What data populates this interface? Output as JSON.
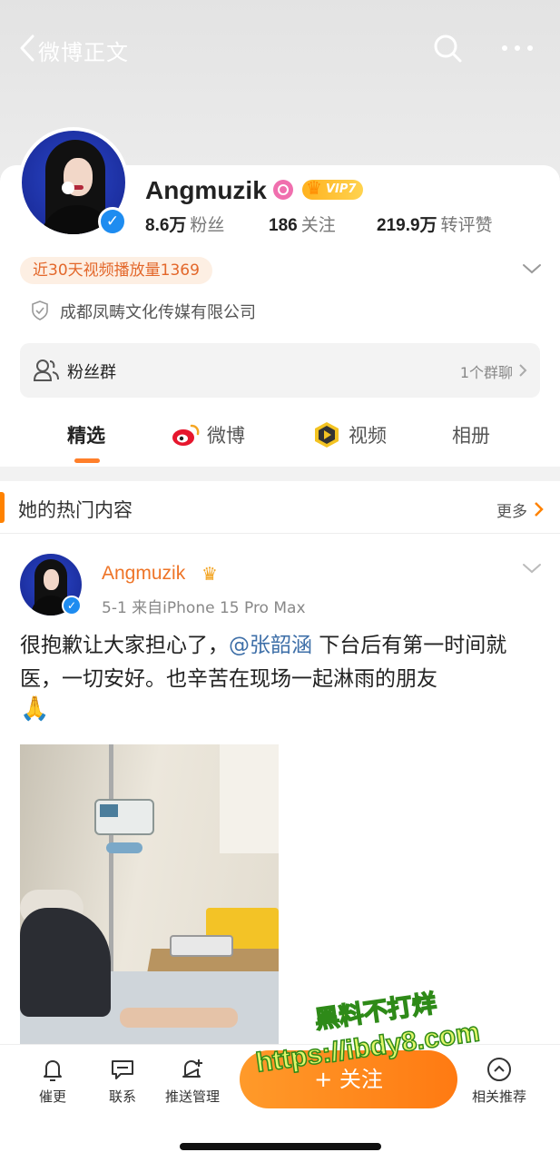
{
  "nav": {
    "title": "微博正文"
  },
  "profile": {
    "name": "Angmuzik",
    "vip_label": "VIP7",
    "stats": [
      {
        "num": "8.6万",
        "label": "粉丝"
      },
      {
        "num": "186",
        "label": "关注"
      },
      {
        "num": "219.9万",
        "label": "转评赞"
      }
    ],
    "video_views": "近30天视频播放量1369",
    "company": "成都凤畴文化传媒有限公司",
    "fans_group": {
      "label": "粉丝群",
      "right": "1个群聊"
    }
  },
  "tabs": [
    "精选",
    "微博",
    "视频",
    "相册"
  ],
  "hot": {
    "title": "她的热门内容",
    "more": "更多"
  },
  "post": {
    "author": "Angmuzik",
    "meta": "5-1  来自iPhone 15 Pro Max",
    "text_before": "很抱歉让大家担心了，",
    "mention": "@张韶涵",
    "text_after": " 下台后有第一时间就医，一切安好。也辛苦在现场一起淋雨的朋友",
    "emoji": "🙏"
  },
  "bottom_bar": {
    "items": [
      "催更",
      "联系",
      "推送管理"
    ],
    "follow": "+ 关注",
    "related": "相关推荐"
  },
  "watermark": {
    "line1": "黑料不打烊",
    "line2": "https://ibdy8.com"
  },
  "colors": {
    "accent": "#ff8200",
    "mention": "#3e6fa8",
    "verified": "#1e8cf0"
  }
}
